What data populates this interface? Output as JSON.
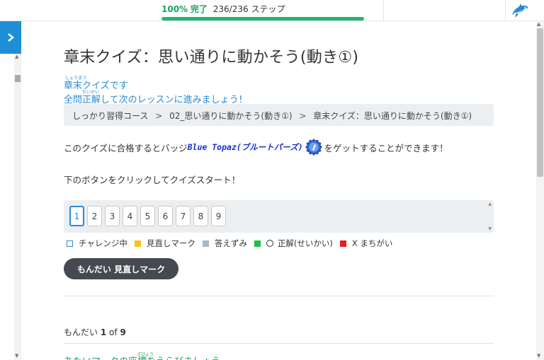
{
  "progress": {
    "percent_label": "100%",
    "done_label": "完了",
    "count_label": "236/236",
    "unit_label": "ステップ",
    "fraction": 1.0,
    "color": "#21b573"
  },
  "page": {
    "title": "章末クイズ：思い通りに動かそう(動き①)"
  },
  "intro": {
    "line1": "章末クイズです",
    "line1_ruby": "しょうまつ",
    "line2": "全問正解して次のレッスンに進みましょう！",
    "line2_ruby": "せいかい"
  },
  "breadcrumb": {
    "items": [
      "しっかり習得コース",
      "02_思い通りに動かそう(動き①)",
      "章末クイズ：思い通りに動かそう(動き①)"
    ],
    "separator": ">"
  },
  "badge": {
    "prefix": "このクイズに合格するとバッジ",
    "name": "Blue Topaz(ブルートパーズ)",
    "suffix": "をゲットすることができます！"
  },
  "start_text": "下のボタンをクリックしてクイズスタート！",
  "questions": {
    "numbers": [
      "1",
      "2",
      "3",
      "4",
      "5",
      "6",
      "7",
      "8",
      "9"
    ],
    "active": "1"
  },
  "legend": [
    {
      "label": "チャレンジ中",
      "kind": "outline",
      "color": "#2b8ad3"
    },
    {
      "label": "見直しマーク",
      "kind": "square",
      "color": "#f5c518"
    },
    {
      "label": "答えずみ",
      "kind": "square",
      "color": "#a9b8c8"
    },
    {
      "label": "正解(せいかい)",
      "kind": "square-circle",
      "color": "#1fbf4a"
    },
    {
      "label": "X まちがい",
      "kind": "square",
      "color": "#e02020"
    }
  ],
  "review_button": "もんだい 見直しマーク",
  "counter": {
    "prefix": "もんだい",
    "current": "1",
    "of": "of",
    "total": "9"
  },
  "next_heading": "あたいマークの座標をえらびましょう",
  "next_heading_ruby": "ざひょう"
}
